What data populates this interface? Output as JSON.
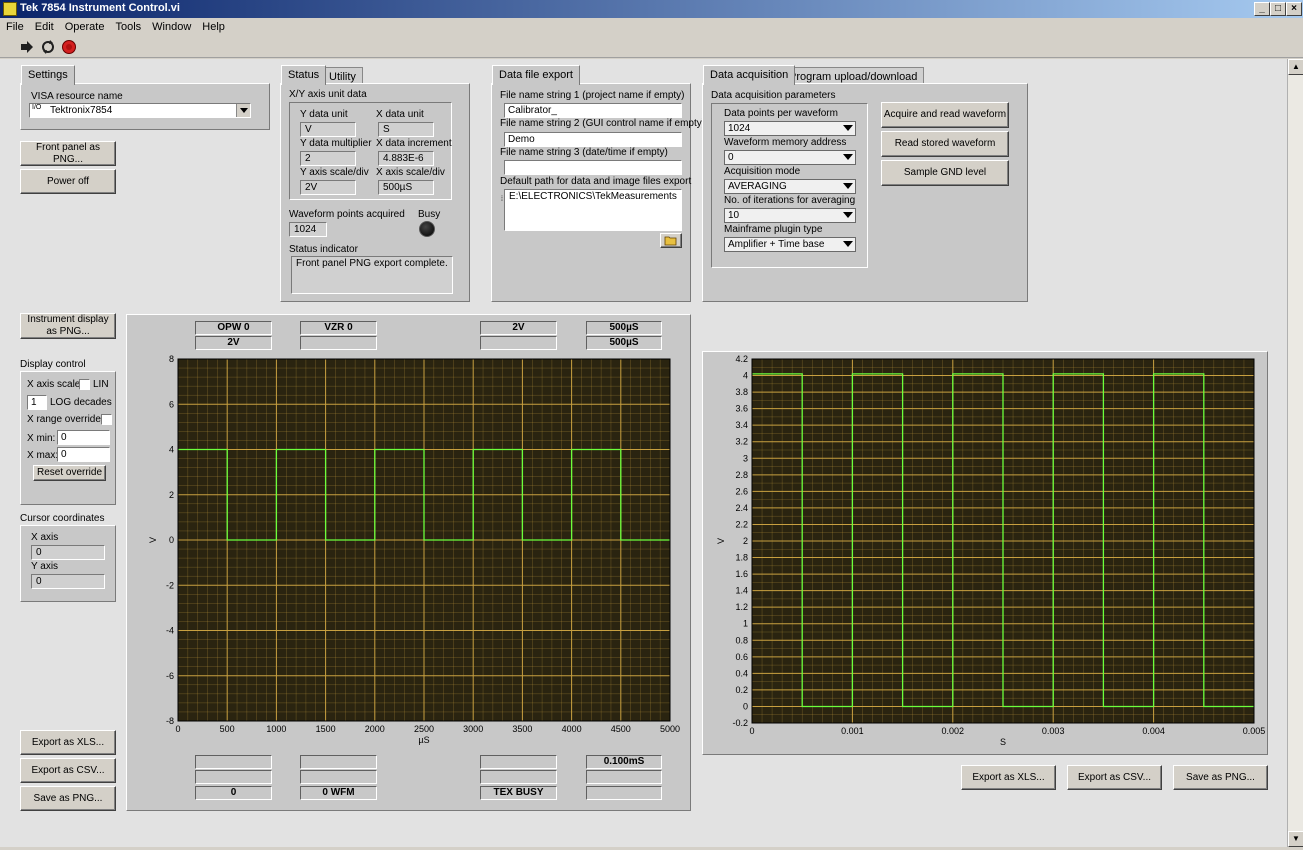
{
  "window": {
    "title": "Tek 7854 Instrument Control.vi"
  },
  "menu": [
    "File",
    "Edit",
    "Operate",
    "Tools",
    "Window",
    "Help"
  ],
  "settings": {
    "tab": "Settings",
    "visa_label": "VISA resource name",
    "visa_value": "Tektronix7854",
    "visa_prefix": "I/O",
    "btn_front_panel": "Front panel as PNG...",
    "btn_power_off": "Power off"
  },
  "status": {
    "tabs": [
      "Status",
      "Utility"
    ],
    "group_title": "X/Y axis unit data",
    "y_unit_label": "Y data unit",
    "y_unit": "V",
    "x_unit_label": "X data unit",
    "x_unit": "S",
    "y_mult_label": "Y data multiplier",
    "y_mult": "2",
    "x_inc_label": "X data increment",
    "x_inc": "4.883E-6",
    "y_scale_label": "Y axis scale/div",
    "y_scale": "2V",
    "x_scale_label": "X axis scale/div",
    "x_scale": "500µS",
    "points_label": "Waveform points acquired",
    "points": "1024",
    "busy_label": "Busy",
    "indicator_label": "Status indicator",
    "indicator_text": "Front panel PNG export complete."
  },
  "export": {
    "tab": "Data file export",
    "s1_label": "File name string 1 (project name if empty)",
    "s1": "Calibrator_",
    "s2_label": "File name string 2 (GUI control name if empty)",
    "s2": "Demo",
    "s3_label": "File name string 3 (date/time if empty)",
    "s3": "",
    "path_label": "Default path for data and  image files export",
    "path": "E:\\ELECTRONICS\\TekMeasurements"
  },
  "acq": {
    "tabs": [
      "Data acquisition",
      "Program upload/download"
    ],
    "params_label": "Data acquisition parameters",
    "dpw_label": "Data points per waveform",
    "dpw": "1024",
    "wma_label": "Waveform memory address",
    "wma": "0",
    "mode_label": "Acquisition mode",
    "mode": "AVERAGING",
    "iter_label": "No. of iterations for averaging",
    "iter": "10",
    "plugin_label": "Mainframe plugin type",
    "plugin": "Amplifier + Time base",
    "btn_acquire": "Acquire and read waveform",
    "btn_read": "Read stored waveform",
    "btn_gnd": "Sample GND level"
  },
  "left": {
    "btn_instr_display": "Instrument display as PNG...",
    "display_control": "Display control",
    "x_axis_scale": "X axis scale:",
    "lin": "LIN",
    "log_value": "1",
    "log_decades": "LOG decades",
    "x_range_override": "X range override:",
    "x_min_label": "X min:",
    "x_min": "0",
    "x_max_label": "X max:",
    "x_max": "0",
    "btn_reset": "Reset override",
    "cursor_coords": "Cursor coordinates",
    "x_axis_label": "X axis",
    "x_axis_value": "0",
    "y_axis_label": "Y axis",
    "y_axis_value": "0",
    "btn_xls": "Export as XLS...",
    "btn_csv": "Export as CSV...",
    "btn_png": "Save as PNG..."
  },
  "readouts": {
    "top1": [
      "OPW 0",
      "VZR 0",
      "",
      "2V",
      "500µS"
    ],
    "top2": [
      "2V",
      "",
      "",
      "",
      "500µS"
    ],
    "bot1": [
      "",
      "",
      "",
      "",
      "0.100mS"
    ],
    "bot2": [
      "",
      "",
      "",
      "",
      ""
    ],
    "bot3": [
      "0",
      "0 WFM",
      "",
      "TEX BUSY",
      ""
    ]
  },
  "right": {
    "btn_xls": "Export as XLS...",
    "btn_csv": "Export as CSV...",
    "btn_png": "Save as PNG..."
  },
  "colors": {
    "plot_bg": "#2a2410",
    "grid": "#c8a040",
    "trace": "#6cff3c"
  },
  "chart_data": [
    {
      "type": "line",
      "xlabel": "µS",
      "ylabel": "V",
      "xlim": [
        0,
        5000
      ],
      "ylim": [
        -8,
        8
      ],
      "x_ticks": [
        0,
        500,
        1000,
        1500,
        2000,
        2500,
        3000,
        3500,
        4000,
        4500,
        5000
      ],
      "y_ticks": [
        8,
        6,
        4,
        2,
        0,
        -2,
        -4,
        -6,
        -8
      ],
      "series": [
        {
          "x": [
            0,
            500,
            500,
            1000,
            1000,
            1500,
            1500,
            2000,
            2000,
            2500,
            2500,
            3000,
            3000,
            3500,
            3500,
            4000,
            4000,
            4500,
            4500,
            5000
          ],
          "y": [
            4,
            4,
            0,
            0,
            4,
            4,
            0,
            0,
            4,
            4,
            0,
            0,
            4,
            4,
            0,
            0,
            4,
            4,
            0,
            0
          ]
        }
      ]
    },
    {
      "type": "line",
      "xlabel": "S",
      "ylabel": "V",
      "xlim": [
        0,
        0.005
      ],
      "ylim": [
        -0.2,
        4.2
      ],
      "x_ticks": [
        "0",
        "0.001",
        "0.002",
        "0.003",
        "0.004",
        "0.005"
      ],
      "y_ticks": [
        "4.2",
        "4",
        "3.8",
        "3.6",
        "3.4",
        "3.2",
        "3",
        "2.8",
        "2.6",
        "2.4",
        "2.2",
        "2",
        "1.8",
        "1.6",
        "1.4",
        "1.2",
        "1",
        "0.8",
        "0.6",
        "0.4",
        "0.2",
        "0",
        "-0.2"
      ],
      "series": [
        {
          "x": [
            0,
            0.0005,
            0.0005,
            0.001,
            0.001,
            0.0015,
            0.0015,
            0.002,
            0.002,
            0.0025,
            0.0025,
            0.003,
            0.003,
            0.0035,
            0.0035,
            0.004,
            0.004,
            0.0045,
            0.0045,
            0.005
          ],
          "y": [
            4.02,
            4.02,
            0.0,
            0.0,
            4.02,
            4.02,
            0.0,
            0.0,
            4.02,
            4.02,
            0.0,
            0.0,
            4.02,
            4.02,
            0.0,
            0.0,
            4.02,
            4.02,
            0.0,
            0.0
          ]
        }
      ]
    }
  ]
}
